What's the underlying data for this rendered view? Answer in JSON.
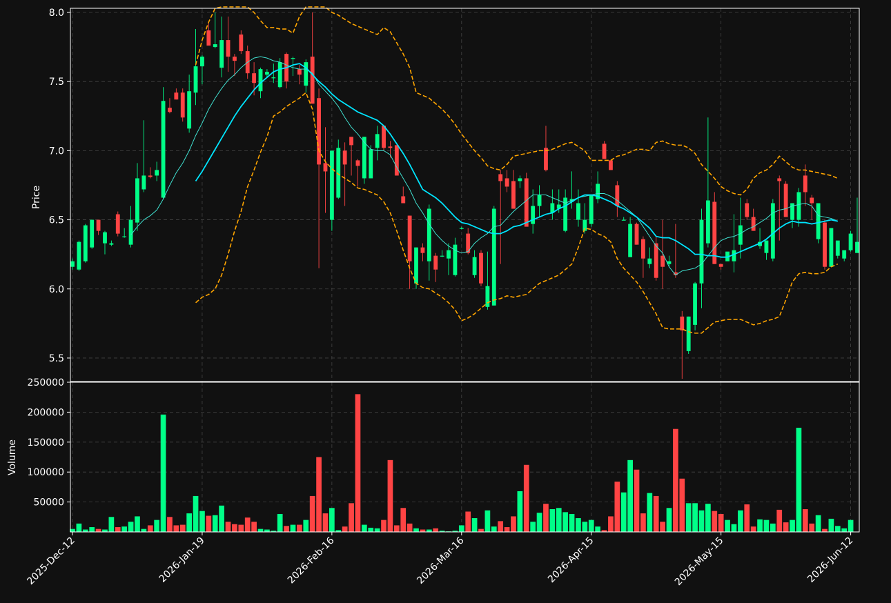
{
  "chart_data": {
    "type": "candlestick",
    "colors": {
      "background": "#111111",
      "up": "#00ff88",
      "down": "#ff4444",
      "ma_fast": "#40e0d0",
      "ma_slow": "#00e5ff",
      "bands": "#ffa500",
      "grid": "#444444",
      "axis": "#ffffff"
    },
    "x_tick_labels": [
      "2025-Dec-12",
      "2026-Jan-19",
      "2026-Feb-16",
      "2026-Mar-16",
      "2026-Apr-15",
      "2026-May-15",
      "2026-Jun-12"
    ],
    "x_tick_index": [
      0,
      20,
      40,
      60,
      80,
      100,
      120
    ],
    "price_panel": {
      "ylabel": "Price",
      "ylim": [
        5.33,
        8.03
      ],
      "y_ticks": [
        5.5,
        6.0,
        6.5,
        7.0,
        7.5,
        8.0
      ],
      "y_tick_labels": [
        "5.5",
        "6.0",
        "6.5",
        "7.0",
        "7.5",
        "8.0"
      ],
      "grid": true
    },
    "volume_panel": {
      "ylabel": "Volume",
      "ylim": [
        0,
        250000
      ],
      "y_ticks": [
        50000,
        100000,
        150000,
        200000,
        250000
      ],
      "y_tick_labels": [
        "50000",
        "100000",
        "150000",
        "200000",
        "250000"
      ],
      "grid": true
    },
    "ohlc": [
      [
        6.16,
        6.22,
        6.14,
        6.2
      ],
      [
        6.14,
        6.35,
        6.13,
        6.34
      ],
      [
        6.2,
        6.47,
        6.19,
        6.46
      ],
      [
        6.3,
        6.5,
        6.29,
        6.5
      ],
      [
        6.5,
        6.5,
        6.39,
        6.42
      ],
      [
        6.33,
        6.42,
        6.25,
        6.41
      ],
      [
        6.32,
        6.35,
        6.31,
        6.33
      ],
      [
        6.54,
        6.56,
        6.38,
        6.4
      ],
      [
        6.38,
        6.44,
        6.37,
        6.38
      ],
      [
        6.32,
        6.6,
        6.3,
        6.5
      ],
      [
        6.48,
        6.91,
        6.42,
        6.8
      ],
      [
        6.72,
        7.22,
        6.7,
        6.82
      ],
      [
        6.82,
        6.88,
        6.8,
        6.81
      ],
      [
        6.82,
        6.92,
        6.78,
        6.86
      ],
      [
        6.66,
        7.46,
        6.65,
        7.36
      ],
      [
        7.31,
        7.38,
        7.27,
        7.28
      ],
      [
        7.42,
        7.45,
        7.37,
        7.37
      ],
      [
        7.42,
        7.45,
        7.21,
        7.24
      ],
      [
        7.16,
        7.55,
        7.13,
        7.43
      ],
      [
        7.42,
        7.88,
        7.33,
        7.61
      ],
      [
        7.61,
        7.69,
        7.48,
        7.68
      ],
      [
        7.87,
        7.92,
        7.77,
        7.76
      ],
      [
        7.75,
        8.0,
        7.74,
        7.77
      ],
      [
        7.6,
        7.97,
        7.53,
        7.8
      ],
      [
        7.8,
        7.97,
        7.57,
        7.68
      ],
      [
        7.68,
        7.7,
        7.54,
        7.65
      ],
      [
        7.84,
        7.87,
        7.7,
        7.72
      ],
      [
        7.72,
        7.76,
        7.52,
        7.56
      ],
      [
        7.56,
        7.64,
        7.4,
        7.49
      ],
      [
        7.43,
        7.6,
        7.38,
        7.59
      ],
      [
        7.55,
        7.59,
        7.53,
        7.57
      ],
      [
        7.53,
        7.63,
        7.49,
        7.53
      ],
      [
        7.46,
        7.67,
        7.45,
        7.64
      ],
      [
        7.7,
        7.71,
        7.45,
        7.5
      ],
      [
        7.67,
        7.68,
        7.54,
        7.67
      ],
      [
        7.59,
        7.62,
        7.48,
        7.55
      ],
      [
        7.47,
        7.66,
        7.42,
        7.64
      ],
      [
        7.68,
        8.0,
        7.34,
        7.34
      ],
      [
        7.38,
        7.45,
        6.15,
        6.9
      ],
      [
        6.91,
        7.17,
        6.55,
        6.85
      ],
      [
        6.5,
        6.99,
        6.42,
        7.0
      ],
      [
        6.66,
        7.08,
        6.65,
        7.02
      ],
      [
        7.0,
        7.06,
        6.6,
        6.9
      ],
      [
        7.1,
        7.1,
        6.82,
        7.04
      ],
      [
        6.93,
        6.94,
        6.74,
        6.89
      ],
      [
        6.8,
        7.1,
        6.76,
        7.1
      ],
      [
        6.8,
        7.04,
        6.8,
        7.01
      ],
      [
        7.02,
        7.18,
        6.93,
        7.12
      ],
      [
        7.18,
        7.18,
        7.0,
        7.02
      ],
      [
        7.03,
        7.07,
        6.95,
        7.02
      ],
      [
        7.04,
        7.04,
        6.82,
        6.82
      ],
      [
        6.67,
        6.74,
        6.62,
        6.62
      ],
      [
        6.53,
        6.53,
        6.0,
        6.2
      ],
      [
        6.04,
        6.3,
        6.0,
        6.3
      ],
      [
        6.3,
        6.33,
        6.2,
        6.26
      ],
      [
        6.2,
        6.61,
        6.06,
        6.58
      ],
      [
        6.24,
        6.26,
        6.05,
        6.14
      ],
      [
        6.24,
        6.28,
        6.23,
        6.24
      ],
      [
        6.22,
        6.33,
        6.1,
        6.28
      ],
      [
        6.1,
        6.37,
        6.09,
        6.32
      ],
      [
        6.44,
        6.45,
        6.43,
        6.44
      ],
      [
        6.4,
        6.44,
        6.25,
        6.26
      ],
      [
        6.1,
        6.28,
        6.08,
        6.23
      ],
      [
        6.26,
        6.28,
        6.02,
        6.04
      ],
      [
        5.87,
        6.27,
        5.85,
        6.02
      ],
      [
        5.88,
        6.6,
        5.88,
        6.58
      ],
      [
        6.83,
        6.86,
        6.18,
        6.78
      ],
      [
        6.8,
        6.86,
        6.7,
        6.74
      ],
      [
        6.78,
        6.86,
        6.58,
        6.58
      ],
      [
        6.78,
        6.82,
        6.73,
        6.8
      ],
      [
        6.8,
        6.84,
        6.47,
        6.45
      ],
      [
        6.47,
        6.72,
        6.4,
        6.6
      ],
      [
        6.6,
        6.75,
        6.52,
        6.68
      ],
      [
        7.02,
        7.18,
        6.85,
        6.86
      ],
      [
        6.55,
        6.72,
        6.5,
        6.62
      ],
      [
        6.58,
        6.72,
        6.55,
        6.61
      ],
      [
        6.42,
        6.72,
        6.41,
        6.66
      ],
      [
        6.63,
        6.85,
        6.58,
        6.65
      ],
      [
        6.5,
        6.72,
        6.45,
        6.62
      ],
      [
        6.42,
        6.62,
        6.4,
        6.5
      ],
      [
        6.47,
        6.58,
        6.45,
        6.68
      ],
      [
        6.65,
        6.85,
        6.62,
        6.76
      ],
      [
        7.05,
        7.07,
        6.94,
        6.94
      ],
      [
        6.93,
        6.93,
        6.86,
        6.86
      ],
      [
        6.75,
        6.78,
        6.52,
        6.6
      ],
      [
        6.5,
        6.52,
        6.5,
        6.5
      ],
      [
        6.23,
        6.52,
        6.23,
        6.47
      ],
      [
        6.47,
        6.48,
        6.32,
        6.32
      ],
      [
        6.36,
        6.38,
        6.08,
        6.22
      ],
      [
        6.18,
        6.3,
        6.15,
        6.22
      ],
      [
        6.33,
        6.38,
        6.06,
        6.08
      ],
      [
        6.24,
        6.5,
        6.0,
        6.16
      ],
      [
        6.18,
        6.24,
        6.16,
        6.2
      ],
      [
        6.12,
        6.47,
        6.08,
        6.1
      ],
      [
        5.8,
        5.84,
        5.35,
        5.7
      ],
      [
        5.55,
        5.8,
        5.53,
        5.8
      ],
      [
        5.74,
        6.05,
        5.7,
        6.04
      ],
      [
        6.04,
        6.58,
        5.86,
        6.5
      ],
      [
        6.33,
        7.24,
        6.3,
        6.64
      ],
      [
        6.63,
        6.7,
        6.18,
        6.18
      ],
      [
        6.18,
        6.18,
        6.14,
        6.16
      ],
      [
        6.2,
        6.2,
        6.2,
        6.27
      ],
      [
        6.2,
        6.54,
        6.12,
        6.28
      ],
      [
        6.32,
        6.66,
        6.22,
        6.46
      ],
      [
        6.62,
        6.65,
        6.5,
        6.52
      ],
      [
        6.52,
        6.58,
        6.42,
        6.42
      ],
      [
        6.31,
        6.44,
        6.29,
        6.34
      ],
      [
        6.26,
        6.35,
        6.21,
        6.35
      ],
      [
        6.22,
        6.65,
        6.2,
        6.62
      ],
      [
        6.8,
        6.82,
        6.35,
        6.78
      ],
      [
        6.76,
        6.78,
        6.52,
        6.52
      ],
      [
        6.5,
        6.62,
        6.44,
        6.62
      ],
      [
        6.5,
        6.73,
        6.45,
        6.7
      ],
      [
        6.82,
        6.9,
        6.6,
        6.7
      ],
      [
        6.66,
        6.68,
        6.5,
        6.62
      ],
      [
        6.36,
        6.62,
        6.33,
        6.62
      ],
      [
        6.48,
        6.5,
        6.14,
        6.16
      ],
      [
        6.16,
        6.44,
        6.16,
        6.44
      ],
      [
        6.24,
        6.34,
        6.22,
        6.35
      ],
      [
        6.22,
        6.27,
        6.2,
        6.28
      ],
      [
        6.28,
        6.42,
        6.27,
        6.4
      ],
      [
        6.26,
        6.66,
        6.26,
        6.34
      ]
    ],
    "volume": [
      5000,
      14000,
      4000,
      8000,
      5000,
      4000,
      25000,
      8000,
      9000,
      17000,
      26000,
      5000,
      11000,
      20000,
      196000,
      25000,
      11000,
      12000,
      31000,
      60000,
      35000,
      27000,
      28000,
      44000,
      17000,
      13000,
      12000,
      24000,
      17000,
      5000,
      4000,
      2000,
      30000,
      10000,
      12000,
      12000,
      20000,
      60000,
      125000,
      31000,
      40000,
      3000,
      9000,
      48000,
      230000,
      12000,
      7000,
      6000,
      20000,
      120000,
      11000,
      40000,
      14000,
      6000,
      4000,
      4000,
      6000,
      2000,
      1000,
      2000,
      11000,
      34000,
      23000,
      5000,
      36000,
      9000,
      18000,
      8000,
      26000,
      68000,
      112000,
      17000,
      32000,
      47000,
      38000,
      40000,
      33000,
      30000,
      23000,
      17000,
      20000,
      9000,
      3000,
      26000,
      84000,
      66000,
      120000,
      104000,
      31000,
      65000,
      60000,
      17000,
      40000,
      172000,
      89000,
      48000,
      48000,
      36000,
      47000,
      35000,
      30000,
      20000,
      13000,
      36000,
      46000,
      9000,
      21000,
      20000,
      14000,
      37000,
      16000,
      20000,
      174000,
      38000,
      14000,
      28000,
      5000,
      22000,
      10000,
      6000,
      20000
    ],
    "ma_fast": [
      null,
      null,
      null,
      null,
      null,
      null,
      null,
      null,
      null,
      6.39,
      6.45,
      6.5,
      6.53,
      6.57,
      6.65,
      6.75,
      6.84,
      6.91,
      7.0,
      7.11,
      7.2,
      7.3,
      7.38,
      7.45,
      7.51,
      7.55,
      7.6,
      7.64,
      7.67,
      7.68,
      7.67,
      7.65,
      7.64,
      7.62,
      7.6,
      7.59,
      7.59,
      7.56,
      7.48,
      7.43,
      7.38,
      7.32,
      7.24,
      7.17,
      7.12,
      7.06,
      7.01,
      7.0,
      7.0,
      6.97,
      6.88,
      6.8,
      6.72,
      6.62,
      6.55,
      6.47,
      6.4,
      6.35,
      6.31,
      6.28,
      6.26,
      6.27,
      6.33,
      6.37,
      6.4,
      6.45,
      6.46,
      6.51,
      6.56,
      6.6,
      6.64,
      6.68,
      6.68,
      6.68,
      6.66,
      6.64,
      6.62,
      6.64,
      6.66,
      6.67,
      6.68,
      6.69,
      6.69,
      6.67,
      6.64,
      6.6,
      6.56,
      6.52,
      6.45,
      6.38,
      6.31,
      6.26,
      6.16,
      6.1,
      6.13,
      6.14,
      6.15,
      6.18,
      6.24,
      6.3,
      6.35,
      6.37,
      6.38,
      6.4,
      6.43,
      6.45,
      6.48,
      6.51,
      6.55,
      6.57,
      6.58,
      6.6,
      6.61,
      6.62,
      6.6,
      6.53,
      6.52,
      6.51,
      6.49
    ],
    "ma_slow": [
      null,
      null,
      null,
      null,
      null,
      null,
      null,
      null,
      null,
      null,
      null,
      null,
      null,
      null,
      null,
      null,
      null,
      null,
      null,
      6.78,
      6.85,
      6.93,
      7.01,
      7.09,
      7.17,
      7.25,
      7.32,
      7.38,
      7.44,
      7.49,
      7.53,
      7.57,
      7.59,
      7.6,
      7.62,
      7.63,
      7.6,
      7.55,
      7.5,
      7.46,
      7.41,
      7.37,
      7.34,
      7.31,
      7.28,
      7.26,
      7.24,
      7.22,
      7.18,
      7.12,
      7.05,
      6.98,
      6.9,
      6.81,
      6.72,
      6.69,
      6.66,
      6.62,
      6.57,
      6.52,
      6.48,
      6.47,
      6.45,
      6.43,
      6.41,
      6.4,
      6.4,
      6.42,
      6.45,
      6.46,
      6.48,
      6.5,
      6.52,
      6.54,
      6.55,
      6.58,
      6.6,
      6.63,
      6.66,
      6.68,
      6.68,
      6.67,
      6.65,
      6.63,
      6.6,
      6.58,
      6.55,
      6.52,
      6.48,
      6.44,
      6.38,
      6.37,
      6.37,
      6.35,
      6.32,
      6.29,
      6.25,
      6.25,
      6.24,
      6.24,
      6.23,
      6.23,
      6.25,
      6.27,
      6.29,
      6.31,
      6.33,
      6.36,
      6.4,
      6.44,
      6.47,
      6.49,
      6.48,
      6.48,
      6.47,
      6.48,
      6.49,
      6.5,
      6.49
    ],
    "band_upper": [
      null,
      null,
      null,
      null,
      null,
      null,
      null,
      null,
      null,
      null,
      null,
      null,
      null,
      null,
      null,
      null,
      null,
      null,
      null,
      7.62,
      7.8,
      7.93,
      8.03,
      8.08,
      8.1,
      8.12,
      8.1,
      8.06,
      8.0,
      7.94,
      7.89,
      7.89,
      7.88,
      7.88,
      7.85,
      7.97,
      8.1,
      8.2,
      8.1,
      8.05,
      8.0,
      7.98,
      7.95,
      7.92,
      7.9,
      7.88,
      7.86,
      7.84,
      7.89,
      7.86,
      7.78,
      7.7,
      7.6,
      7.42,
      7.4,
      7.38,
      7.34,
      7.3,
      7.25,
      7.19,
      7.12,
      7.06,
      7.0,
      6.95,
      6.89,
      6.87,
      6.86,
      6.9,
      6.96,
      6.97,
      6.98,
      6.99,
      7.0,
      7.0,
      7.01,
      7.03,
      7.05,
      7.06,
      7.03,
      7.0,
      6.93,
      6.93,
      6.93,
      6.93,
      6.96,
      6.97,
      6.99,
      7.01,
      7.01,
      7.0,
      7.06,
      7.07,
      7.05,
      7.04,
      7.04,
      7.02,
      6.98,
      6.9,
      6.85,
      6.8,
      6.74,
      6.71,
      6.69,
      6.68,
      6.72,
      6.8,
      6.84,
      6.86,
      6.9,
      6.96,
      6.92,
      6.88,
      6.86,
      6.86,
      6.85,
      6.84,
      6.83,
      6.82,
      6.8
    ],
    "band_lower": [
      null,
      null,
      null,
      null,
      null,
      null,
      null,
      null,
      null,
      null,
      null,
      null,
      null,
      null,
      null,
      null,
      null,
      null,
      null,
      5.9,
      5.94,
      5.96,
      6.0,
      6.1,
      6.25,
      6.42,
      6.56,
      6.74,
      6.86,
      6.99,
      7.1,
      7.25,
      7.28,
      7.32,
      7.35,
      7.38,
      7.42,
      7.3,
      7.0,
      6.92,
      6.87,
      6.83,
      6.8,
      6.77,
      6.73,
      6.72,
      6.7,
      6.68,
      6.63,
      6.55,
      6.42,
      6.28,
      6.15,
      6.04,
      6.01,
      6.0,
      5.97,
      5.94,
      5.9,
      5.85,
      5.77,
      5.79,
      5.82,
      5.86,
      5.9,
      5.92,
      5.93,
      5.95,
      5.94,
      5.95,
      5.96,
      6.0,
      6.04,
      6.06,
      6.08,
      6.1,
      6.14,
      6.18,
      6.3,
      6.44,
      6.43,
      6.4,
      6.38,
      6.34,
      6.22,
      6.15,
      6.1,
      6.05,
      5.98,
      5.9,
      5.82,
      5.72,
      5.71,
      5.71,
      5.71,
      5.69,
      5.68,
      5.68,
      5.72,
      5.76,
      5.77,
      5.78,
      5.78,
      5.78,
      5.76,
      5.74,
      5.75,
      5.77,
      5.78,
      5.8,
      5.92,
      6.05,
      6.11,
      6.12,
      6.11,
      6.11,
      6.12,
      6.16,
      6.18
    ]
  }
}
